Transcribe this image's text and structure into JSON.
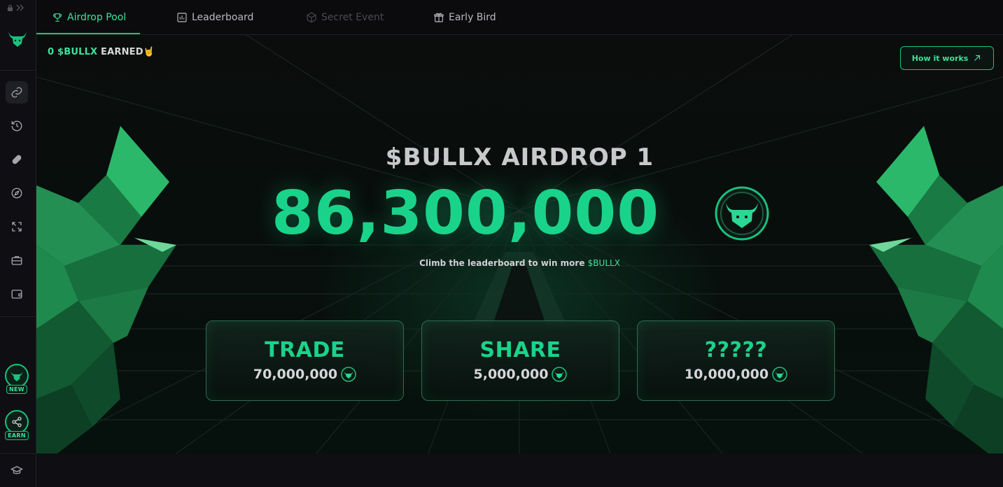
{
  "nav": {
    "tabs": [
      {
        "label": "Airdrop Pool",
        "icon": "trophy-icon",
        "state": "active"
      },
      {
        "label": "Leaderboard",
        "icon": "bar-chart-icon",
        "state": "normal"
      },
      {
        "label": "Secret Event",
        "icon": "cube-icon",
        "state": "disabled"
      },
      {
        "label": "Early Bird",
        "icon": "gift-icon",
        "state": "normal"
      }
    ]
  },
  "sidebar": {
    "icons": [
      "link-icon",
      "history-icon",
      "pill-icon",
      "compass-icon",
      "swap-icon",
      "briefcase-icon",
      "wallet-icon"
    ],
    "badges": [
      {
        "label": "NEW",
        "icon": "bull-icon"
      },
      {
        "label": "EARN",
        "icon": "share-icon"
      }
    ],
    "bottom_icon": "graduation-cap-icon"
  },
  "earned": {
    "amount": "0 $BULLX",
    "label": "EARNED",
    "emoji": "🤘"
  },
  "how_button": {
    "label": "How it works"
  },
  "hero": {
    "title": "$BULLX AIRDROP 1",
    "amount": "86,300,000",
    "subtitle": "Climb the leaderboard to win more",
    "subtitle_token": "$BULLX"
  },
  "cards": [
    {
      "title": "TRADE",
      "amount": "70,000,000"
    },
    {
      "title": "SHARE",
      "amount": "5,000,000"
    },
    {
      "title": "?????",
      "amount": "10,000,000"
    }
  ],
  "colors": {
    "accent": "#19c27e",
    "accent_bright": "#3ee29a",
    "background": "#0b0b0e"
  }
}
